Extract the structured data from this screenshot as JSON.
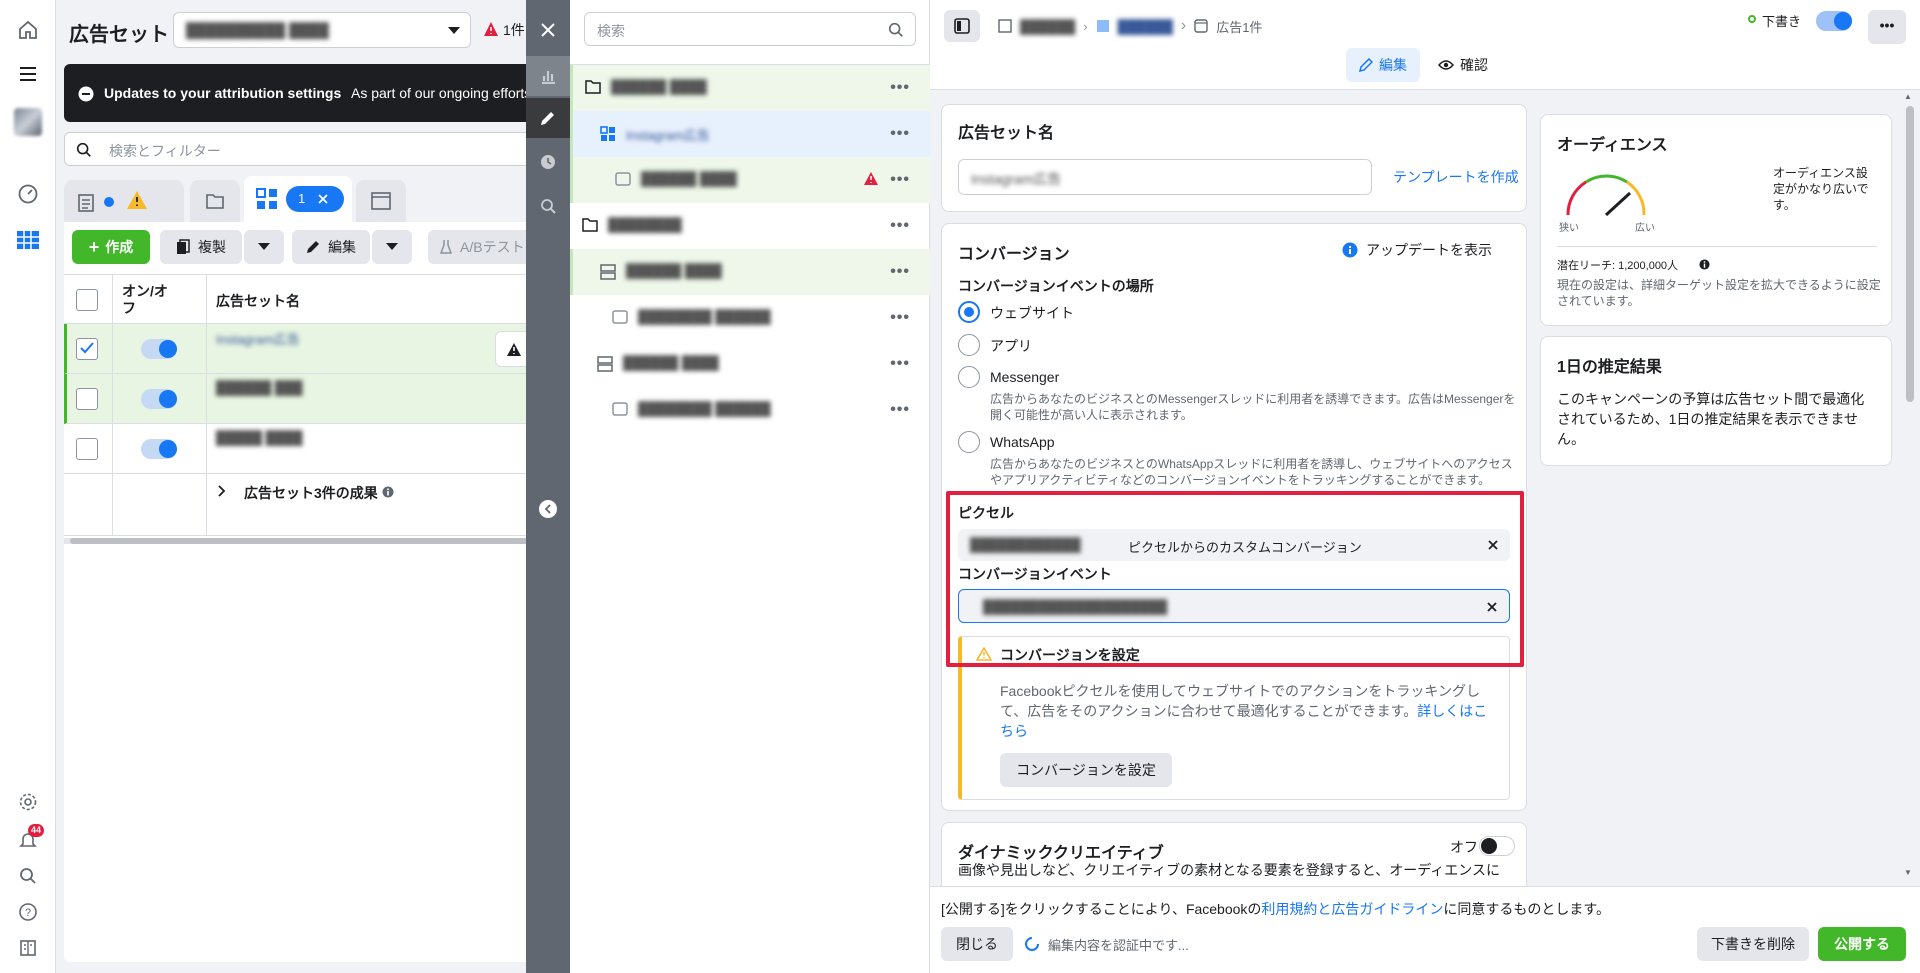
{
  "left_panel": {
    "title": "広告セット",
    "account_selector": "██████████ ████",
    "error_count": "1件",
    "notice_title": "Updates to your attribution settings",
    "notice_text": "As part of our ongoing efforts",
    "search_placeholder": "検索とフィルター",
    "selection_count": "1",
    "toolbar": {
      "create": "作成",
      "duplicate": "複製",
      "edit": "編集",
      "ab_test": "A/Bテスト"
    },
    "table": {
      "col_onoff": "オン/オフ",
      "col_name": "広告セット名",
      "rows": [
        {
          "name": "Instagram広告",
          "checked": true,
          "on": true
        },
        {
          "name": "██████ ███",
          "checked": false,
          "on": true
        },
        {
          "name": "█████ ████",
          "checked": false,
          "on": true
        }
      ],
      "summary": "広告セット3件の成果"
    }
  },
  "rail": {
    "notification_badge": "44"
  },
  "tree": {
    "search_placeholder": "検索",
    "items": [
      {
        "label": "██████ ████",
        "type": "campaign",
        "state": "green"
      },
      {
        "label": "Instagram広告",
        "type": "adset",
        "state": "selected"
      },
      {
        "label": "██████ ████",
        "type": "ad",
        "state": "green",
        "warning": true
      },
      {
        "label": "████████",
        "type": "campaign",
        "state": "normal"
      },
      {
        "label": "██████ ████",
        "type": "adset",
        "state": "green"
      },
      {
        "label": "████████ ██████",
        "type": "ad",
        "state": "normal"
      },
      {
        "label": "██████ ████",
        "type": "adset",
        "state": "normal"
      },
      {
        "label": "████████ ██████",
        "type": "ad",
        "state": "normal"
      }
    ]
  },
  "editor": {
    "breadcrumb": {
      "campaign": "██████",
      "adset": "██████",
      "ad": "広告1件"
    },
    "draft_label": "下書き",
    "tab_edit": "編集",
    "tab_review": "確認",
    "adset_name_section": {
      "title": "広告セット名",
      "value": "Instagram広告",
      "template_link": "テンプレートを作成"
    },
    "conversion": {
      "title": "コンバージョン",
      "update_link": "アップデートを表示",
      "location_label": "コンバージョンイベントの場所",
      "options": [
        {
          "label": "ウェブサイト",
          "selected": true,
          "desc": ""
        },
        {
          "label": "アプリ",
          "selected": false,
          "desc": ""
        },
        {
          "label": "Messenger",
          "selected": false,
          "desc": "広告からあなたのビジネスとのMessengerスレッドに利用者を誘導できます。広告はMessengerを開く可能性が高い人に表示されます。"
        },
        {
          "label": "WhatsApp",
          "selected": false,
          "desc": "広告からあなたのビジネスとのWhatsAppスレッドに利用者を誘導し、ウェブサイトへのアクセスやアプリアクティビティなどのコンバージョンイベントをトラッキングすることができます。"
        }
      ],
      "pixel_label": "ピクセル",
      "pixel_value_blur": "████████████",
      "pixel_value": "ピクセルからのカスタムコンバージョン",
      "event_label": "コンバージョンイベント",
      "event_value": "████████████████████",
      "warning_title": "コンバージョンを設定",
      "warning_text": "Facebookピクセルを使用してウェブサイトでのアクションをトラッキングして、広告をそのアクションに合わせて最適化することができます。",
      "warning_link": "詳しくはこちら",
      "warning_button": "コンバージョンを設定"
    },
    "dynamic": {
      "title": "ダイナミッククリエイティブ",
      "toggle_label": "オフ",
      "desc": "画像や見出しなど、クリエイティブの素材となる要素を登録すると、オーディエンスに"
    },
    "audience": {
      "title": "オーディエンス",
      "gauge_low": "狭い",
      "gauge_high": "広い",
      "description": "オーディエンス設定がかなり広いです。",
      "reach": "潜在リーチ: 1,200,000人",
      "reach_note": "現在の設定は、詳細ターゲット設定を拡大できるように設定されています。"
    },
    "estimate": {
      "title": "1日の推定結果",
      "text": "このキャンペーンの予算は広告セット間で最適化されているため、1日の推定結果を表示できません。"
    },
    "footer": {
      "terms_prefix": "[公開する]をクリックすることにより、Facebookの",
      "terms_link": "利用規約と広告ガイドライン",
      "terms_suffix": "に同意するものとします。",
      "close": "閉じる",
      "status": "編集内容を認証中です...",
      "delete_draft": "下書きを削除",
      "publish": "公開する"
    }
  },
  "colors": {
    "accent": "#1877f2",
    "green": "#42b72a",
    "highlight": "#e41e3f",
    "warning": "#f7b928"
  }
}
